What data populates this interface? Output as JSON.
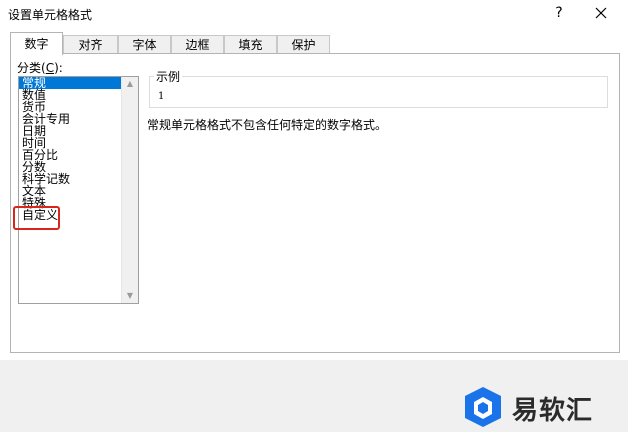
{
  "window": {
    "title": "设置单元格格式",
    "help_label": "?"
  },
  "tabs": [
    {
      "label": "数字",
      "active": true
    },
    {
      "label": "对齐"
    },
    {
      "label": "字体"
    },
    {
      "label": "边框"
    },
    {
      "label": "填充"
    },
    {
      "label": "保护"
    }
  ],
  "category": {
    "label_prefix": "分类(",
    "label_key": "C",
    "label_suffix": "):",
    "items": [
      "常规",
      "数值",
      "货币",
      "会计专用",
      "日期",
      "时间",
      "百分比",
      "分数",
      "科学记数",
      "文本",
      "特殊",
      "自定义"
    ],
    "selected": "常规"
  },
  "sample": {
    "title": "示例",
    "value": "1"
  },
  "description": "常规单元格格式不包含任何特定的数字格式。",
  "watermark": {
    "text": "易软汇"
  },
  "colors": {
    "selection": "#0078d7",
    "highlight_border": "#d9261c",
    "logo_blue": "#1a73e8"
  }
}
